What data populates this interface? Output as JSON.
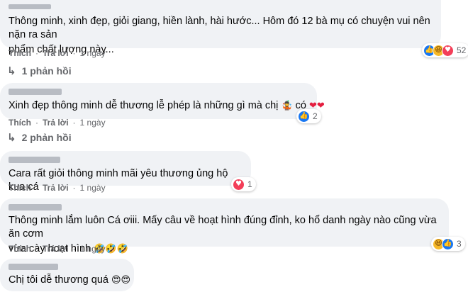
{
  "actions": {
    "like_label": "Thích",
    "reply_label": "Trả lời",
    "separator": "·",
    "time": "1 ngày"
  },
  "comments": [
    {
      "text_line1": "Thông minh, xinh đẹp, giỏi giang, hiền lành, hài hước... Hôm đó 12 bà mụ có chuyện vui nên nặn ra sản",
      "text_line2": "phẩm chất lượng này...",
      "reactions": [
        "like",
        "haha",
        "love"
      ],
      "reaction_count": "52",
      "replies_label": "1 phản hồi"
    },
    {
      "text": "Xinh đẹp thông minh dễ thương lễ phép là những gì mà chị",
      "text_after": "có",
      "emoji_mid": "🤹",
      "emoji_end": "❤❤",
      "reactions": [
        "like"
      ],
      "reaction_count": "2",
      "replies_label": "2 phản hồi"
    },
    {
      "text": "Cara rất giỏi thông minh mãi yêu thương ủng hộ kua cá",
      "reactions": [
        "love"
      ],
      "reaction_count": "1"
    },
    {
      "text_line1": "Thông minh lắm luôn Cá ơiii. Mấy câu về hoạt hình đúng đỉnh, ko hổ danh ngày nào cũng vừa ăn cơm",
      "text_line2": "vừa cày hoạt hình",
      "emoji_end": "🤣🤣🤣",
      "reactions": [
        "haha",
        "like"
      ],
      "reaction_count": "3"
    },
    {
      "text": "Chị tôi dễ thương quá",
      "emoji_end": "😍😍"
    }
  ],
  "colors": {
    "bubble": "#f0f2f5",
    "meta_text": "#65676b",
    "like": "#1877f2",
    "love": "#f33e58",
    "haha": "#f7b928"
  }
}
